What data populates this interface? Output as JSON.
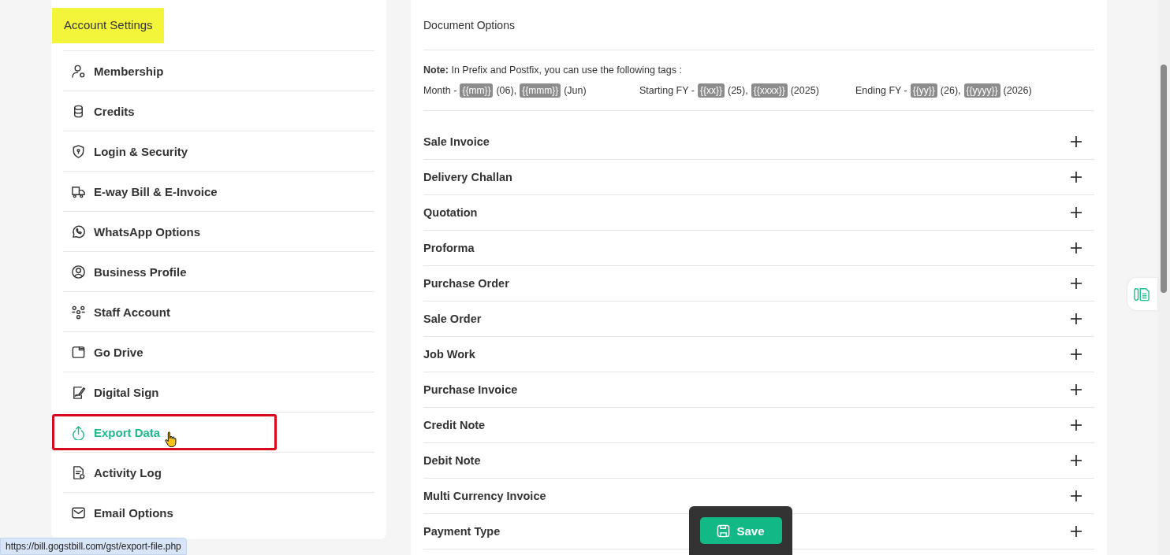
{
  "sidebar": {
    "title": "Account Settings",
    "items": [
      {
        "label": "Membership",
        "selected": false,
        "outlined": false
      },
      {
        "label": "Credits",
        "selected": false,
        "outlined": false
      },
      {
        "label": "Login & Security",
        "selected": false,
        "outlined": false
      },
      {
        "label": "E-way Bill & E-Invoice",
        "selected": false,
        "outlined": false
      },
      {
        "label": "WhatsApp Options",
        "selected": false,
        "outlined": false
      },
      {
        "label": "Business Profile",
        "selected": false,
        "outlined": false
      },
      {
        "label": "Staff Account",
        "selected": false,
        "outlined": false
      },
      {
        "label": "Go Drive",
        "selected": false,
        "outlined": false
      },
      {
        "label": "Digital Sign",
        "selected": false,
        "outlined": false
      },
      {
        "label": "Export Data",
        "selected": true,
        "outlined": true
      },
      {
        "label": "Activity Log",
        "selected": false,
        "outlined": false
      },
      {
        "label": "Email Options",
        "selected": false,
        "outlined": false
      }
    ]
  },
  "document_options": {
    "title": "Document Options",
    "note": "**Note:** In Prefix and Postfix, you can use the following tags :",
    "tag_groups": [
      {
        "label": "Month -",
        "tags": [
          {
            "tag": "{{mm}}",
            "example": "(06),"
          },
          {
            "tag": "{{mmm}}",
            "example": "(Jun)"
          }
        ]
      },
      {
        "label": "Starting FY -",
        "tags": [
          {
            "tag": "{{xx}}",
            "example": "(25),"
          },
          {
            "tag": "{{xxxx}}",
            "example": "(2025)"
          }
        ]
      },
      {
        "label": "Ending FY -",
        "tags": [
          {
            "tag": "{{yy}}",
            "example": "(26),"
          },
          {
            "tag": "{{yyyy}}",
            "example": "(2026)"
          }
        ]
      }
    ],
    "sections": [
      {
        "label": "Sale Invoice",
        "expanded": false
      },
      {
        "label": "Delivery Challan",
        "expanded": false
      },
      {
        "label": "Quotation",
        "expanded": false
      },
      {
        "label": "Proforma",
        "expanded": false
      },
      {
        "label": "Purchase Order",
        "expanded": false
      },
      {
        "label": "Sale Order",
        "expanded": false
      },
      {
        "label": "Job Work",
        "expanded": false
      },
      {
        "label": "Purchase Invoice",
        "expanded": false
      },
      {
        "label": "Credit Note",
        "expanded": false
      },
      {
        "label": "Debit Note",
        "expanded": false
      },
      {
        "label": "Multi Currency Invoice",
        "expanded": false
      },
      {
        "label": "Payment Type",
        "expanded": false
      }
    ]
  },
  "save_button": "Save",
  "status_bar": "https://bill.gogstbill.com/gst/export-file.php"
}
